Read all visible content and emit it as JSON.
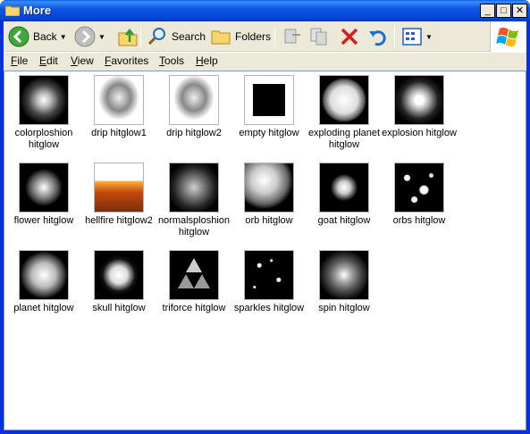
{
  "window": {
    "title": "More"
  },
  "toolbar": {
    "back_label": "Back",
    "search_label": "Search",
    "folders_label": "Folders"
  },
  "menu": [
    "File",
    "Edit",
    "View",
    "Favorites",
    "Tools",
    "Help"
  ],
  "items": [
    {
      "label": "colorploshion hitglow",
      "style": "colorploshion"
    },
    {
      "label": "drip hitglow1",
      "style": "drip"
    },
    {
      "label": "drip hitglow2",
      "style": "drip"
    },
    {
      "label": "empty hitglow",
      "style": "empty"
    },
    {
      "label": "exploding planet hitglow",
      "style": "exploding"
    },
    {
      "label": "explosion hitglow",
      "style": "explosion"
    },
    {
      "label": "flower hitglow",
      "style": "flower"
    },
    {
      "label": "hellfire hitglow2",
      "style": "hellfire"
    },
    {
      "label": "normalsploshion hitglow",
      "style": "normal"
    },
    {
      "label": "orb hitglow",
      "style": "orb"
    },
    {
      "label": "goat hitglow",
      "style": "goat"
    },
    {
      "label": "orbs hitglow",
      "style": "orbs"
    },
    {
      "label": "planet hitglow",
      "style": "planet"
    },
    {
      "label": "skull hitglow",
      "style": "skull"
    },
    {
      "label": "triforce hitglow",
      "style": "triforce"
    },
    {
      "label": "sparkles hitglow",
      "style": "sparkles"
    },
    {
      "label": "spin hitglow",
      "style": "spin"
    }
  ]
}
